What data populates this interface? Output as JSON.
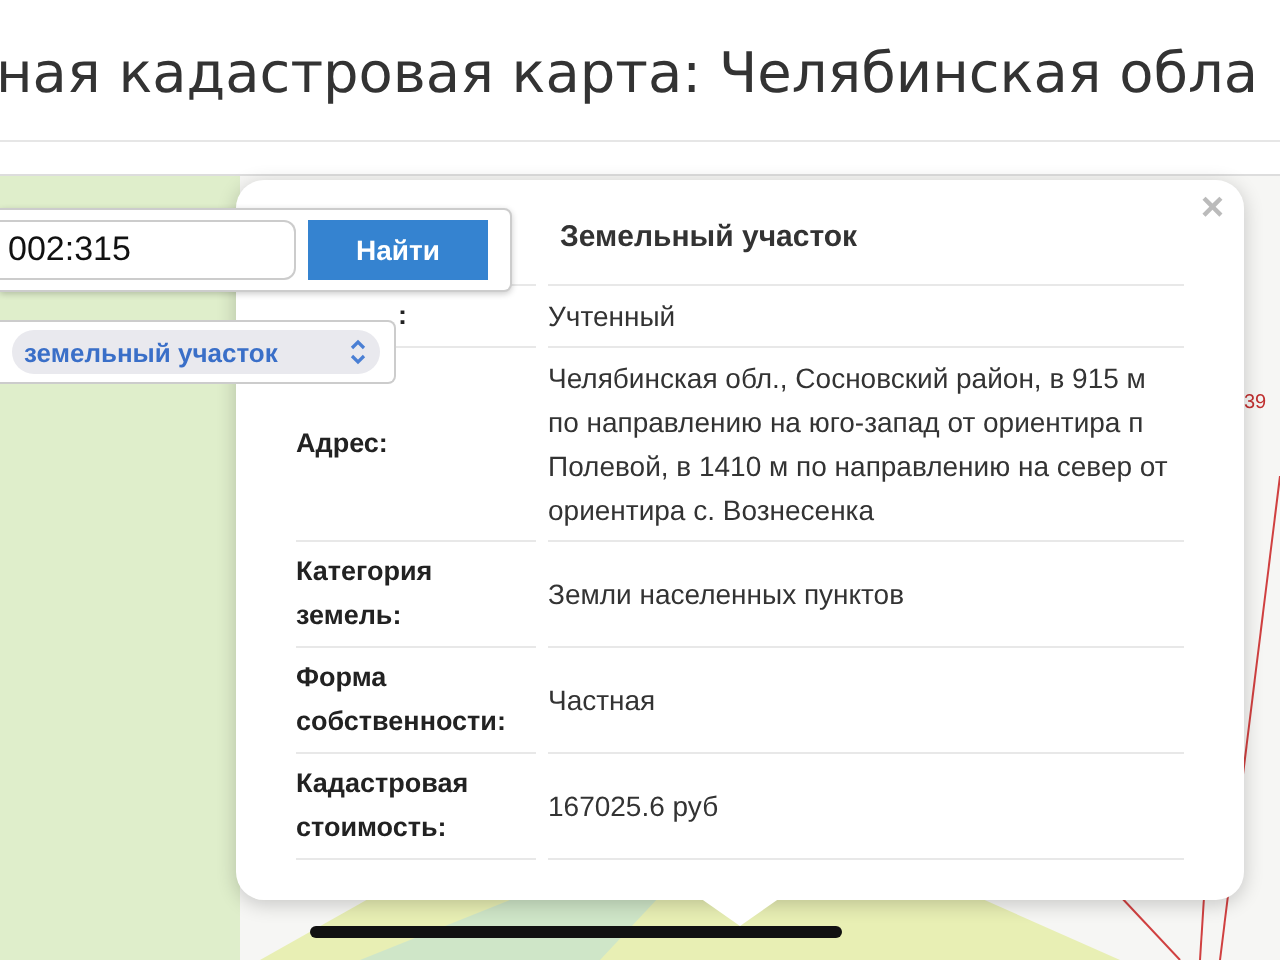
{
  "page_title": "ная кадастровая карта: Челябинская обла",
  "search": {
    "value": "002:315",
    "button": "Найти"
  },
  "object_type": {
    "value": "земельный участок"
  },
  "popup": {
    "title": "Земельный участок",
    "close": "×",
    "rows": [
      {
        "kind": "covered",
        "label": ":",
        "value": "Учтенный"
      },
      {
        "kind": "plain",
        "label": "Адрес:",
        "value": "Челябинская обл., Сосновский район, в 915 м по направлению на юго-запад от ориентира п Полевой, в 1410 м по направлению на север от ориентира с. Вознесенка"
      },
      {
        "kind": "plain",
        "label": "Категория земель:",
        "value": "Земли населенных пунктов"
      },
      {
        "kind": "plain",
        "label": "Форма собственности:",
        "value": "Частная"
      },
      {
        "kind": "plain",
        "label": "Кадастровая стоимость:",
        "value": "167025.6 руб"
      }
    ]
  },
  "map_label": "39"
}
